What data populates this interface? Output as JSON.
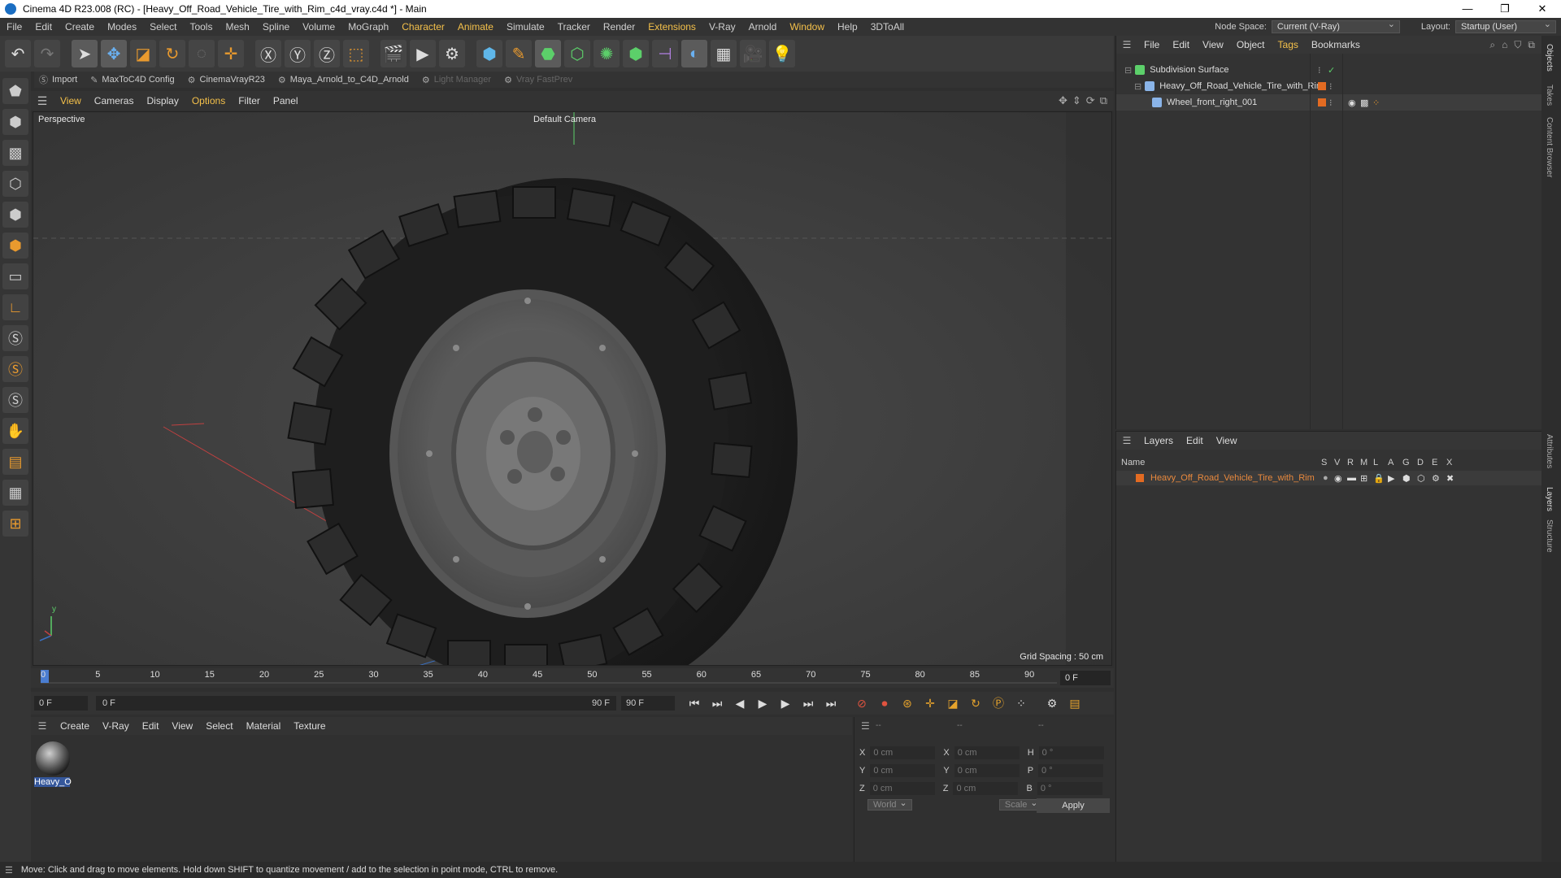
{
  "titlebar": {
    "title": "Cinema 4D R23.008 (RC) - [Heavy_Off_Road_Vehicle_Tire_with_Rim_c4d_vray.c4d *] - Main",
    "min": "—",
    "max": "❐",
    "close": "✕"
  },
  "menubar": {
    "items": [
      "File",
      "Edit",
      "Create",
      "Modes",
      "Select",
      "Tools",
      "Mesh",
      "Spline",
      "Volume",
      "MoGraph",
      "Character",
      "Animate",
      "Simulate",
      "Tracker",
      "Render",
      "Extensions",
      "V-Ray",
      "Arnold",
      "Window",
      "Help",
      "3DToAll"
    ],
    "node_space_label": "Node Space:",
    "node_space_value": "Current (V-Ray)",
    "layout_label": "Layout:",
    "layout_value": "Startup (User)"
  },
  "pluginbar": {
    "items": [
      "Import",
      "MaxToC4D Config",
      "CinemaVrayR23",
      "Maya_Arnold_to_C4D_Arnold",
      "Light Manager",
      "Vray FastPrev"
    ]
  },
  "viewport_menu": {
    "items": [
      "View",
      "Cameras",
      "Display",
      "Options",
      "Filter",
      "Panel"
    ]
  },
  "viewport": {
    "label": "Perspective",
    "camera": "Default Camera",
    "grid_spacing": "Grid Spacing : 50 cm",
    "axis_y": "y",
    "axis_x": "x",
    "axis_z": "z"
  },
  "timeline": {
    "ticks": [
      "0",
      "5",
      "10",
      "15",
      "20",
      "25",
      "30",
      "35",
      "40",
      "45",
      "50",
      "55",
      "60",
      "65",
      "70",
      "75",
      "80",
      "85",
      "90"
    ],
    "current_frame": "0 F"
  },
  "playback": {
    "start": "0 F",
    "range_start": "0 F",
    "range_end": "90 F",
    "end": "90 F"
  },
  "material_manager": {
    "menu": [
      "Create",
      "V-Ray",
      "Edit",
      "View",
      "Select",
      "Material",
      "Texture"
    ],
    "material_name": "Heavy_O"
  },
  "coords": {
    "header": [
      "--",
      "--",
      "--"
    ],
    "rows": [
      {
        "a": "X",
        "av": "0 cm",
        "b": "X",
        "bv": "0 cm",
        "c": "H",
        "cv": "0 °"
      },
      {
        "a": "Y",
        "av": "0 cm",
        "b": "Y",
        "bv": "0 cm",
        "c": "P",
        "cv": "0 °"
      },
      {
        "a": "Z",
        "av": "0 cm",
        "b": "Z",
        "bv": "0 cm",
        "c": "B",
        "cv": "0 °"
      }
    ],
    "space": "World",
    "mode": "Scale",
    "apply": "Apply"
  },
  "object_manager": {
    "menu": [
      "File",
      "Edit",
      "View",
      "Object",
      "Tags",
      "Bookmarks"
    ],
    "objects": [
      {
        "name": "Subdivision Surface",
        "level": 0
      },
      {
        "name": "Heavy_Off_Road_Vehicle_Tire_with_Rim",
        "level": 1
      },
      {
        "name": "Wheel_front_right_001",
        "level": 2
      }
    ]
  },
  "layer_manager": {
    "menu": [
      "Layers",
      "Edit",
      "View"
    ],
    "columns": [
      "Name",
      "S",
      "V",
      "R",
      "M",
      "L",
      "A",
      "G",
      "D",
      "E",
      "X"
    ],
    "layer_name": "Heavy_Off_Road_Vehicle_Tire_with_Rim"
  },
  "sidetabs": [
    "Objects",
    "Takes",
    "Content Browser",
    "Attributes",
    "Layers",
    "Structure"
  ],
  "status": "Move: Click and drag to move elements. Hold down SHIFT to quantize movement / add to the selection in point mode, CTRL to remove.",
  "colors": {
    "accent": "#f4c04a",
    "layer": "#e36b22",
    "selection": "#35579b"
  }
}
